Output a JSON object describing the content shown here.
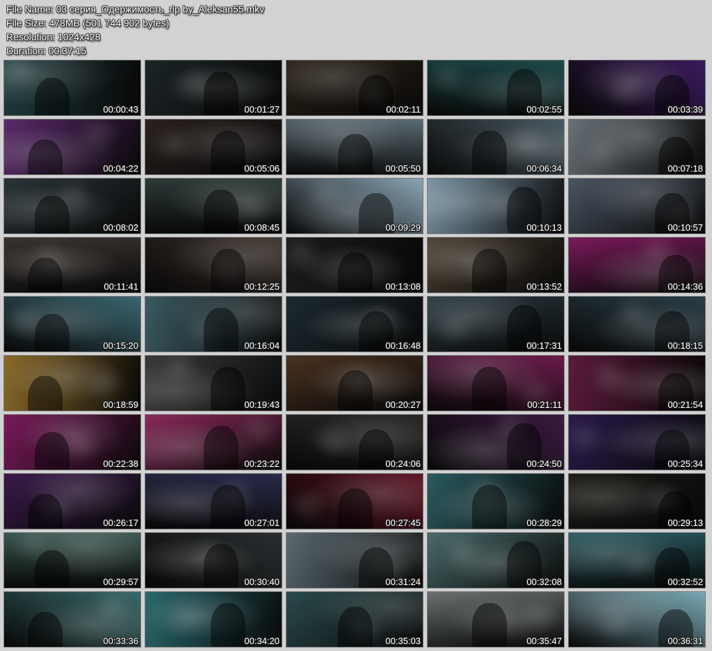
{
  "header": {
    "file_name": "File Name: 03 серия_Одержимость_rip by_Aleksan55.mkv",
    "file_size": "File Size: 478MB (501 744 902 bytes)",
    "resolution": "Resolution: 1024x428",
    "duration": "Duration: 00:37:15"
  },
  "thumbnails": [
    {
      "time": "00:00:43",
      "tone": "#1f3a3c"
    },
    {
      "time": "00:01:27",
      "tone": "#1c2426"
    },
    {
      "time": "00:02:11",
      "tone": "#2a2218"
    },
    {
      "time": "00:02:55",
      "tone": "#1d4a4a"
    },
    {
      "time": "00:03:39",
      "tone": "#3a1a5a"
    },
    {
      "time": "00:04:22",
      "tone": "#5a2a6a"
    },
    {
      "time": "00:05:06",
      "tone": "#2a2220"
    },
    {
      "time": "00:05:50",
      "tone": "#5a6a72"
    },
    {
      "time": "00:06:34",
      "tone": "#4a5a62"
    },
    {
      "time": "00:07:18",
      "tone": "#6a7278"
    },
    {
      "time": "00:08:02",
      "tone": "#2a3438"
    },
    {
      "time": "00:08:45",
      "tone": "#2c3a38"
    },
    {
      "time": "00:09:29",
      "tone": "#8aa4b4"
    },
    {
      "time": "00:10:13",
      "tone": "#7a94a4"
    },
    {
      "time": "00:10:57",
      "tone": "#4a5462"
    },
    {
      "time": "00:11:41",
      "tone": "#3a3430"
    },
    {
      "time": "00:12:25",
      "tone": "#3a302a"
    },
    {
      "time": "00:13:08",
      "tone": "#1a1c1a"
    },
    {
      "time": "00:13:52",
      "tone": "#4a4032"
    },
    {
      "time": "00:14:36",
      "tone": "#7a1a5a"
    },
    {
      "time": "00:15:20",
      "tone": "#3a6670"
    },
    {
      "time": "00:16:04",
      "tone": "#3a5a62"
    },
    {
      "time": "00:16:48",
      "tone": "#1c2a30"
    },
    {
      "time": "00:17:31",
      "tone": "#2a3a40"
    },
    {
      "time": "00:18:15",
      "tone": "#2a3e46"
    },
    {
      "time": "00:18:59",
      "tone": "#8a6a2a"
    },
    {
      "time": "00:19:43",
      "tone": "#3a3a3c"
    },
    {
      "time": "00:20:27",
      "tone": "#4a3220"
    },
    {
      "time": "00:21:11",
      "tone": "#6a1a4a"
    },
    {
      "time": "00:21:54",
      "tone": "#5a1a3a"
    },
    {
      "time": "00:22:38",
      "tone": "#7a1a5a"
    },
    {
      "time": "00:23:22",
      "tone": "#8a2a5a"
    },
    {
      "time": "00:24:06",
      "tone": "#2a2826"
    },
    {
      "time": "00:24:50",
      "tone": "#3a1a40"
    },
    {
      "time": "00:25:34",
      "tone": "#2a1a4a"
    },
    {
      "time": "00:26:17",
      "tone": "#3a1a4a"
    },
    {
      "time": "00:27:01",
      "tone": "#2a2a4a"
    },
    {
      "time": "00:27:45",
      "tone": "#5a1020"
    },
    {
      "time": "00:28:29",
      "tone": "#2a5a5e"
    },
    {
      "time": "00:29:13",
      "tone": "#1a1a16"
    },
    {
      "time": "00:29:57",
      "tone": "#3a5650"
    },
    {
      "time": "00:30:40",
      "tone": "#2a2e30"
    },
    {
      "time": "00:31:24",
      "tone": "#5a6a70"
    },
    {
      "time": "00:32:08",
      "tone": "#4a6a6a"
    },
    {
      "time": "00:32:52",
      "tone": "#2a5a60"
    },
    {
      "time": "00:33:36",
      "tone": "#3a6a6a"
    },
    {
      "time": "00:34:20",
      "tone": "#2a6a6e"
    },
    {
      "time": "00:35:03",
      "tone": "#2a4a4c"
    },
    {
      "time": "00:35:47",
      "tone": "#6a7070"
    },
    {
      "time": "00:36:31",
      "tone": "#7aaab6"
    }
  ]
}
